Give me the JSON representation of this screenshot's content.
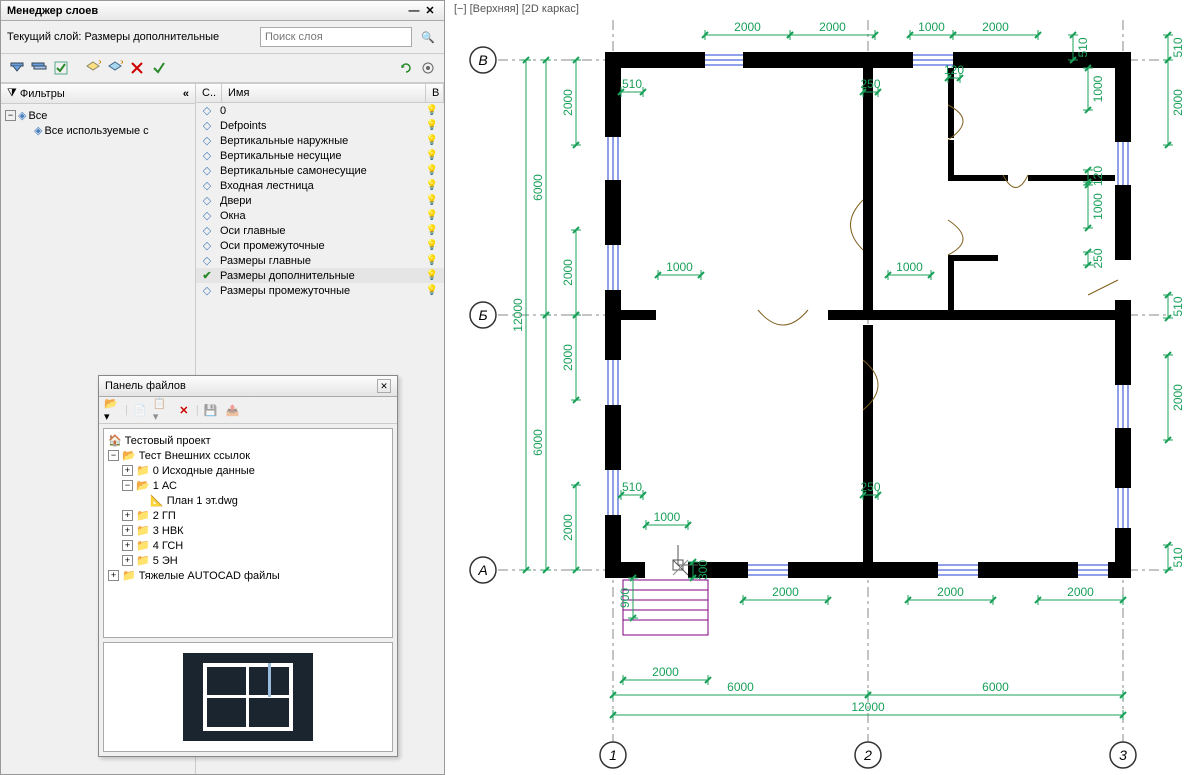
{
  "layer_mgr": {
    "title": "Менеджер слоев",
    "current_label": "Текущий слой: Размеры дополнительные",
    "search_placeholder": "Поиск слоя",
    "filters_title": "Фильтры",
    "filter_all": "Все",
    "filter_used": "Все используемые с",
    "col_status": "С..",
    "col_name": "Имя",
    "col_on": "В",
    "layers": [
      {
        "name": "0",
        "current": false
      },
      {
        "name": "Defpoints",
        "current": false
      },
      {
        "name": "Вертикальные наружные",
        "current": false
      },
      {
        "name": "Вертикальные несущие",
        "current": false
      },
      {
        "name": "Вертикальные самонесущие",
        "current": false
      },
      {
        "name": "Входная лестница",
        "current": false
      },
      {
        "name": "Двери",
        "current": false
      },
      {
        "name": "Окна",
        "current": false
      },
      {
        "name": "Оси главные",
        "current": false
      },
      {
        "name": "Оси промежуточные",
        "current": false
      },
      {
        "name": "Размеры главные",
        "current": false
      },
      {
        "name": "Размеры дополнительные",
        "current": true
      },
      {
        "name": "Размеры промежуточные",
        "current": false
      }
    ]
  },
  "file_panel": {
    "title": "Панель файлов",
    "tree": {
      "root": "Тестовый проект",
      "folder1": "Тест Внешних ссылок",
      "f1_1": "0 Исходные данные",
      "f1_2": "1 АС",
      "f1_2_file": "План 1 эт.dwg",
      "f1_3": "2 ГП",
      "f1_4": "3 НВК",
      "f1_5": "4 ГСН",
      "f1_6": "5 ЭН",
      "folder2": "Тяжелые AUTOCAD файлы"
    }
  },
  "canvas": {
    "view_label_minus": "[−]",
    "view_label_top": "[Верхняя]",
    "view_label_mode": "[2D каркас]",
    "axes_h": [
      "В",
      "Б",
      "А"
    ],
    "axes_v": [
      "1",
      "2",
      "3"
    ],
    "dims": {
      "top_main": [
        "2000",
        "2000",
        "1000",
        "2000"
      ],
      "top_side": "510",
      "left_main": [
        "6000",
        "12000",
        "6000"
      ],
      "left_segments": [
        "2000",
        "2000",
        "2000"
      ],
      "inner_510_left": "510",
      "inner_250_top": "250",
      "inner_120_top": "120",
      "inner_1000_right": [
        "1000",
        "120",
        "1000",
        "250"
      ],
      "inner_1000_mid": [
        "1000",
        "1000"
      ],
      "inner_510_bottom": "510",
      "inner_250_bottom": "250",
      "right_510_top": "510",
      "right_2000": [
        "2000",
        "2000"
      ],
      "right_510_mid": "510",
      "right_510_bot": "510",
      "bottom_inner_1000": "1000",
      "bottom_300": "300",
      "bottom_900": "900",
      "bottom_2000s": [
        "2000",
        "2000",
        "2000"
      ],
      "bottom_stair_2000": "2000",
      "bottom_6000s": [
        "6000",
        "6000"
      ],
      "bottom_12000": "12000"
    }
  }
}
